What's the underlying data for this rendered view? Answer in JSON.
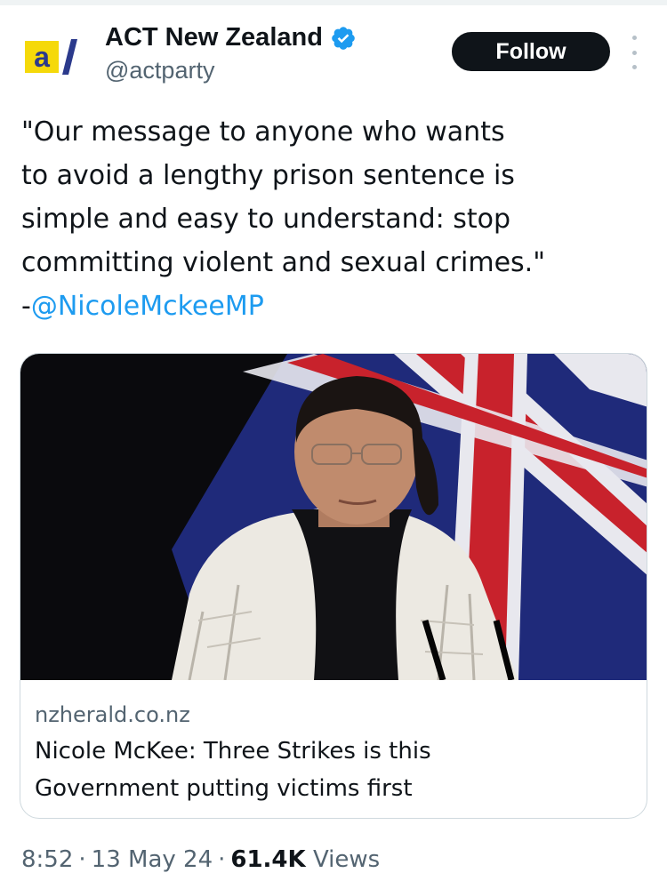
{
  "header": {
    "display_name": "ACT New Zealand",
    "handle": "@actparty",
    "follow_label": "Follow",
    "logo_text": "a/"
  },
  "tweet": {
    "lines": [
      "\"Our message to anyone who wants",
      "to avoid a lengthy prison sentence is",
      "simple and easy to understand: stop",
      "committing violent and sexual crimes.\""
    ],
    "mention_prefix": "-",
    "mention": "@NicoleMckeeMP"
  },
  "card": {
    "domain": "nzherald.co.nz",
    "title_lines": [
      "Nicole McKee: Three Strikes is this",
      "Government putting victims first"
    ]
  },
  "meta": {
    "time": "8:52",
    "date": "13 May 24",
    "views_count": "61.4K",
    "views_label": "Views",
    "separator": "·"
  },
  "colors": {
    "text": "#0f1419",
    "secondary": "#536471",
    "accent": "#1d9bf0",
    "logo_yellow": "#f5d90a",
    "logo_blue": "#2b3a8c"
  },
  "icons": {
    "verified": "verified-badge-icon",
    "more": "more-options-icon"
  }
}
